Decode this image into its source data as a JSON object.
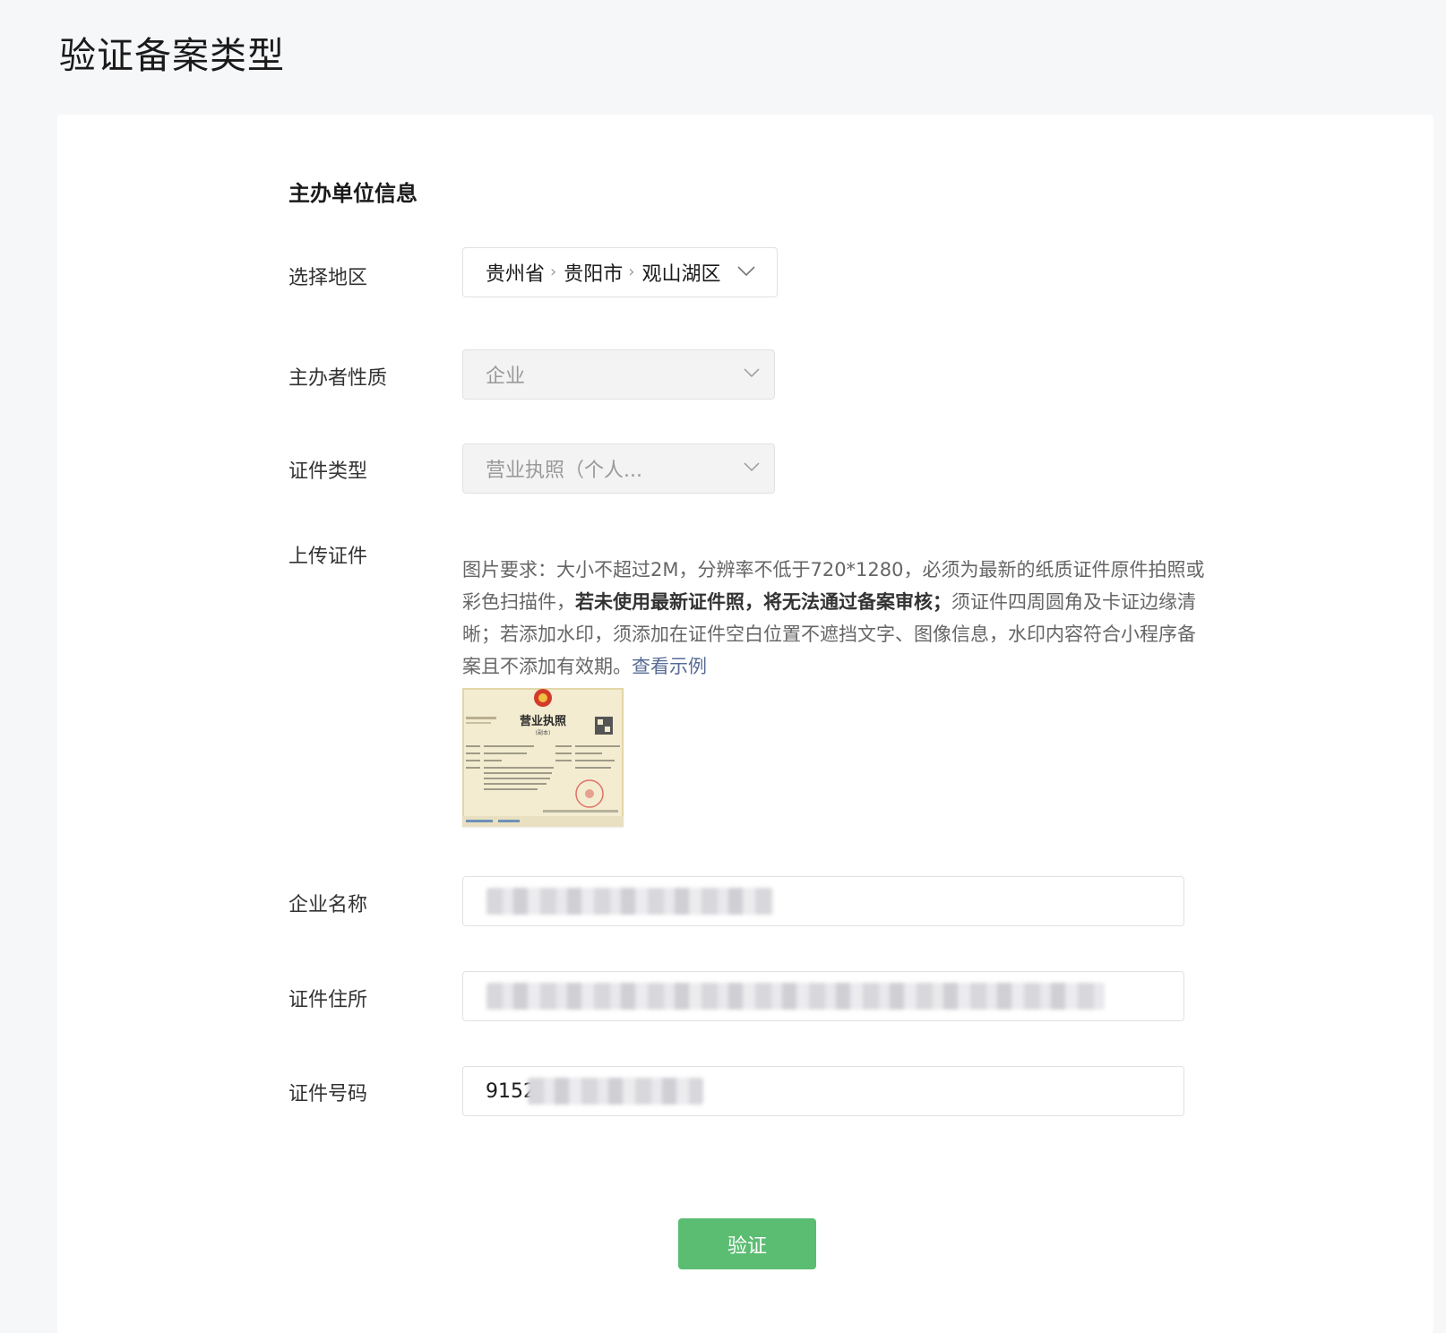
{
  "page": {
    "title": "验证备案类型"
  },
  "form": {
    "section_title": "主办单位信息",
    "region": {
      "label": "选择地区",
      "province": "贵州省",
      "city": "贵阳市",
      "district": "观山湖区"
    },
    "organizer_type": {
      "label": "主办者性质",
      "value": "企业"
    },
    "cert_type": {
      "label": "证件类型",
      "value": "营业执照（个人..."
    },
    "upload": {
      "label": "上传证件",
      "desc_part1": "图片要求：大小不超过2M，分辨率不低于720*1280，必须为最新的纸质证件原件拍照或彩色扫描件，",
      "desc_bold": "若未使用最新证件照，将无法通过备案审核；",
      "desc_part2": "须证件四周圆角及卡证边缘清晰；若添加水印，须添加在证件空白位置不遮挡文字、图像信息，水印内容符合小程序备案且不添加有效期。",
      "example_link": "查看示例",
      "thumbnail": {
        "title_text": "营业执照",
        "subtitle_text": "(副本)"
      }
    },
    "company_name": {
      "label": "企业名称",
      "value": ""
    },
    "cert_address": {
      "label": "证件住所",
      "value": ""
    },
    "cert_number": {
      "label": "证件号码",
      "value": "9152"
    }
  },
  "actions": {
    "verify_label": "验证"
  },
  "colors": {
    "accent_green": "#5bbd72",
    "link": "#576b95",
    "page_bg": "#f6f7f9"
  }
}
